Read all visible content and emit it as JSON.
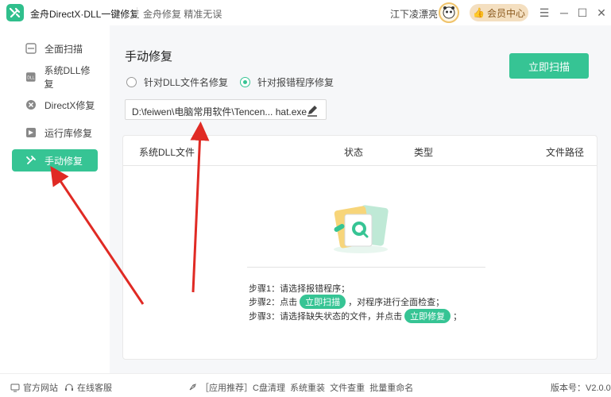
{
  "window": {
    "title": "金舟DirectX·DLL一键修复",
    "slogan": "金舟修复 精准无误",
    "username": "江下凌漂亮",
    "vip_label": "会员中心"
  },
  "sidebar": {
    "items": [
      {
        "label": "全面扫描",
        "icon": "scan-icon"
      },
      {
        "label": "系统DLL修复",
        "icon": "dll-icon"
      },
      {
        "label": "DirectX修复",
        "icon": "directx-icon"
      },
      {
        "label": "运行库修复",
        "icon": "runtime-icon"
      },
      {
        "label": "手动修复",
        "icon": "wrench-icon"
      }
    ]
  },
  "main": {
    "title": "手动修复",
    "radio_dll": "针对DLL文件名修复",
    "radio_program": "针对报错程序修复",
    "path_value": "D:\\feiwen\\电脑常用软件\\Tencen... hat.exe",
    "scan_button": "立即扫描",
    "table_headers": [
      "系统DLL文件",
      "状态",
      "类型",
      "文件路径"
    ],
    "steps": {
      "step1": "步骤1：请选择报错程序；",
      "step2_pre": "步骤2：点击",
      "step2_btn": "立即扫描",
      "step2_post": "，对程序进行全面检查；",
      "step3_pre": "步骤3：请选择缺失状态的文件，并点击",
      "step3_btn": "立即修复",
      "step3_post": "；"
    }
  },
  "footer": {
    "website": "官方网站",
    "support": "在线客服",
    "links": "［应用推荐］C盘清理  系统重装  文件查重  批量重命名",
    "version": "版本号：V2.0.0"
  },
  "colors": {
    "accent": "#36c494",
    "vip": "#f4dfc0",
    "arrow": "#e02a24"
  }
}
